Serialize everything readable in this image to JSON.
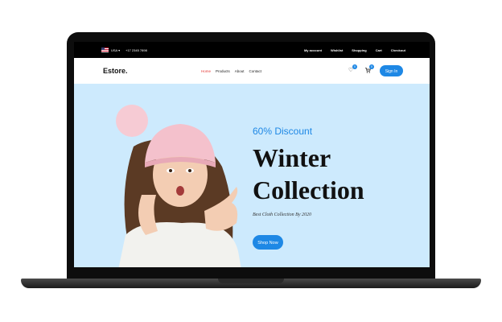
{
  "topbar": {
    "language": "USA ▾",
    "phone": "+17 2345 7898",
    "links": [
      "My account",
      "Wishlist",
      "Shopping",
      "Cart",
      "Checkout"
    ]
  },
  "navbar": {
    "logo": "Estore.",
    "links": [
      "Home",
      "Products",
      "About",
      "Contact"
    ],
    "active_link": "Home",
    "wishlist_count": "0",
    "cart_count": "0",
    "signin_label": "Sign In"
  },
  "hero": {
    "discount": "60% Discount",
    "heading_line1": "Winter",
    "heading_line2": "Collection",
    "subtitle": "Best Cloth Collection By 2020",
    "cta_label": "Shop Now"
  },
  "colors": {
    "accent": "#1e88e5",
    "hero_bg": "#cdeafd",
    "active_link": "#e53935"
  }
}
